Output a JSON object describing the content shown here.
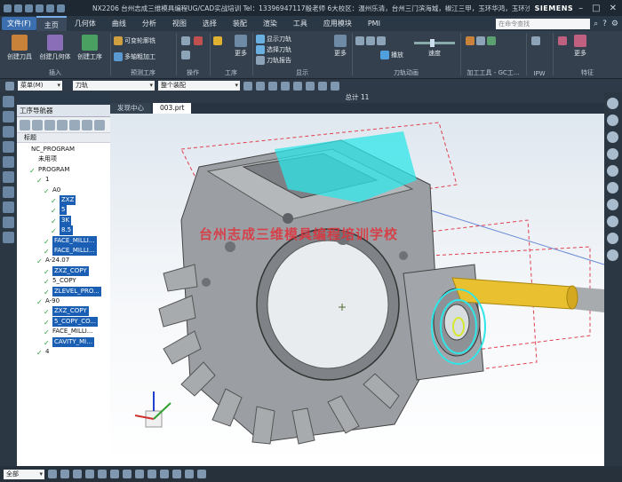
{
  "titlebar": {
    "title": "NX2206 台州志成三维模具编程UG/CAD实战培训  Tel：13396947117殷老师 6大校区：温州乐清，台州三门滨海城，椒江三甲，玉环华鸿，玉环沙门，玉环坎门 - 加工",
    "brand": "SIEMENS"
  },
  "menubar": {
    "file": "文件(F)",
    "items": [
      "主页",
      "几何体",
      "曲线",
      "分析",
      "视图",
      "选择",
      "装配",
      "渲染",
      "工具",
      "应用模块",
      "PMI"
    ],
    "search_placeholder": "在命令查找"
  },
  "ribbon": {
    "insert": {
      "name": "插入",
      "buttons": [
        "创建刀具",
        "创建几何体",
        "创建工序"
      ]
    },
    "preview": {
      "name": "预测工序",
      "buttons": [
        "可变轮廓铣",
        "多轴粗加工"
      ]
    },
    "operate": {
      "name": "操作"
    },
    "process": {
      "name": "工序",
      "more": "更多"
    },
    "display": {
      "name": "显示",
      "buttons": [
        "显示刀轨",
        "选择刀轨",
        "刀轨报告"
      ],
      "more": "更多"
    },
    "toolpath_anim": {
      "name": "刀轨动画",
      "play": "播放",
      "speed": "速度"
    },
    "machining_tools": {
      "name": "加工工具 - GC工..."
    },
    "ipw": {
      "name": "IPW"
    },
    "features": {
      "name": "特征",
      "more": "更多"
    }
  },
  "toolbar2": {
    "menu": "菜单(M)",
    "filter": "刀轨",
    "scope": "整个装配"
  },
  "viewport": {
    "title": "总计 11",
    "tabs": [
      "发现中心",
      "003.prt"
    ],
    "watermark": "台州志成三维模具编程培训学校"
  },
  "nav": {
    "title": "工序导航器",
    "col": "标题",
    "tree": [
      {
        "label": "NC_PROGRAM",
        "level": 0,
        "sel": false,
        "check": false
      },
      {
        "label": "未用项",
        "level": 1,
        "sel": false,
        "check": false
      },
      {
        "label": "PROGRAM",
        "level": 1,
        "sel": false,
        "check": true
      },
      {
        "label": "1",
        "level": 2,
        "sel": false,
        "check": true
      },
      {
        "label": "A0",
        "level": 3,
        "sel": false,
        "check": true
      },
      {
        "label": "ZXZ",
        "level": 4,
        "sel": true,
        "check": true
      },
      {
        "label": "5",
        "level": 4,
        "sel": true,
        "check": true
      },
      {
        "label": "3K",
        "level": 4,
        "sel": true,
        "check": true
      },
      {
        "label": "8.5",
        "level": 4,
        "sel": true,
        "check": true
      },
      {
        "label": "FACE_MILLI...",
        "level": 3,
        "sel": true,
        "check": true
      },
      {
        "label": "FACE_MILLI...",
        "level": 3,
        "sel": true,
        "check": true
      },
      {
        "label": "A-24.07",
        "level": 2,
        "sel": false,
        "check": true
      },
      {
        "label": "ZXZ_COPY",
        "level": 3,
        "sel": true,
        "check": true
      },
      {
        "label": "5_COPY",
        "level": 3,
        "sel": false,
        "check": true
      },
      {
        "label": "ZLEVEL_PRO...",
        "level": 3,
        "sel": true,
        "check": true
      },
      {
        "label": "A-90",
        "level": 2,
        "sel": false,
        "check": true
      },
      {
        "label": "ZXZ_COPY",
        "level": 3,
        "sel": true,
        "check": true
      },
      {
        "label": "5_COPY_CO...",
        "level": 3,
        "sel": true,
        "check": true
      },
      {
        "label": "FACE_MILLI...",
        "level": 3,
        "sel": false,
        "check": true
      },
      {
        "label": "CAVITY_MI...",
        "level": 3,
        "sel": true,
        "check": true
      },
      {
        "label": "4",
        "level": 2,
        "sel": false,
        "check": true
      }
    ]
  },
  "status": {
    "filter": "全部"
  }
}
